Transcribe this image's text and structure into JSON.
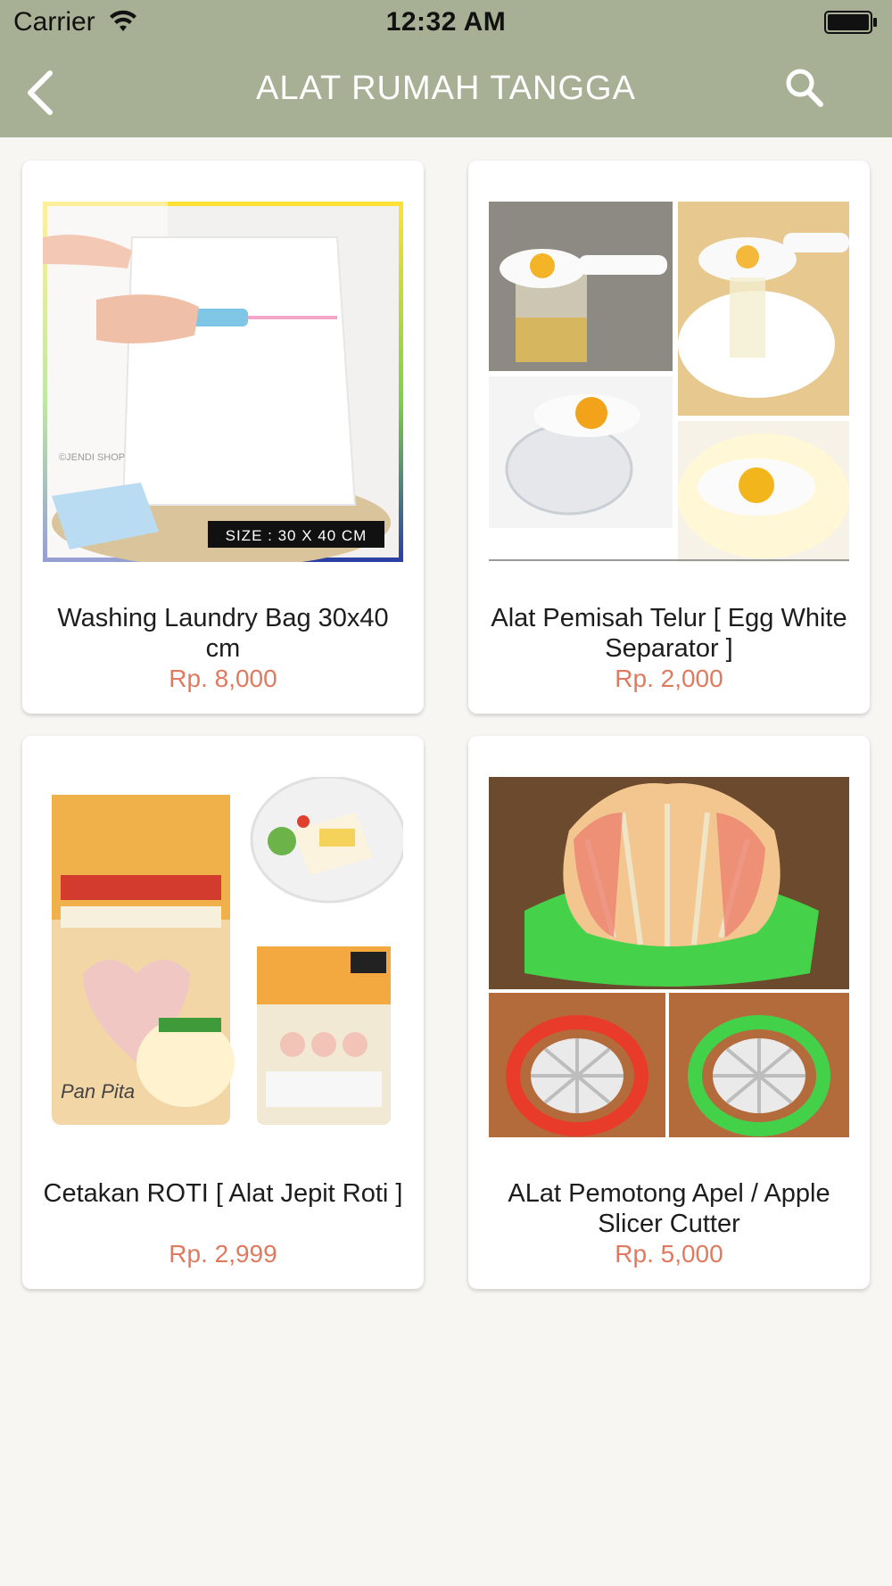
{
  "status_bar": {
    "carrier": "Carrier",
    "time": "12:32 AM"
  },
  "nav": {
    "title": "ALAT RUMAH TANGGA",
    "back_icon": "chevron-left-icon",
    "search_icon": "search-icon"
  },
  "products": [
    {
      "name": "Washing Laundry Bag 30x40 cm",
      "price": "Rp. 8,000",
      "image_text": "SIZE : 30 X 40 CM",
      "watermark": "©JENDI SHOP"
    },
    {
      "name": "Alat Pemisah Telur [ Egg White Separator ]",
      "price": "Rp. 2,000"
    },
    {
      "name": "Cetakan ROTI [ Alat Jepit Roti ]",
      "price": "Rp. 2,999",
      "image_text": "Pan Pita"
    },
    {
      "name": "ALat Pemotong Apel / Apple Slicer Cutter",
      "price": "Rp. 5,000"
    }
  ],
  "colors": {
    "nav_bg": "#a7b094",
    "price": "#e07a5f",
    "page_bg": "#f7f6f3"
  }
}
